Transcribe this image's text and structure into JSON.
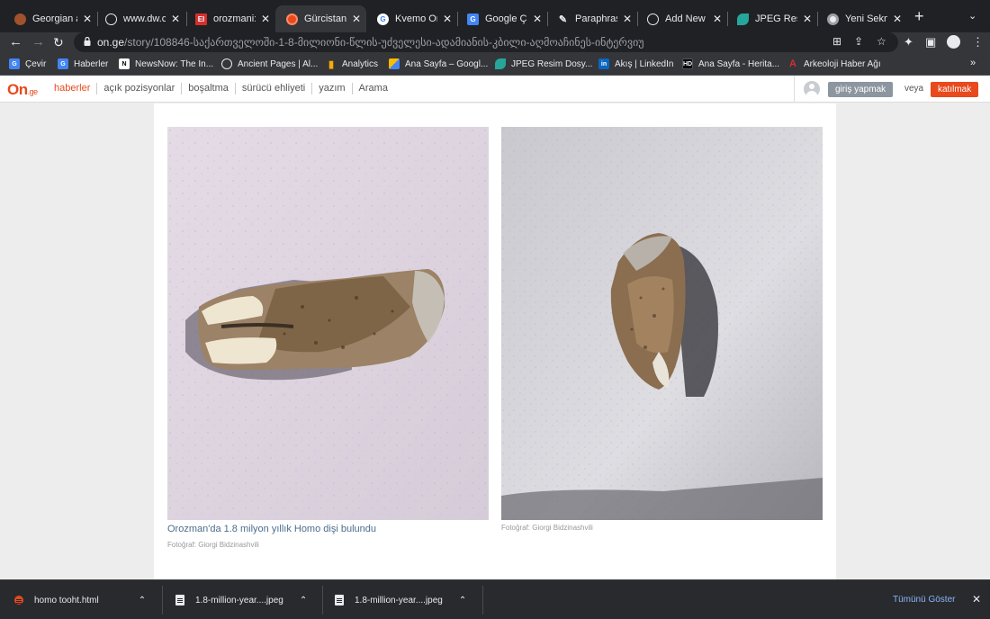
{
  "tabs": [
    {
      "title": "Georgian ar",
      "icon": "brown-circle-icon",
      "color": "#a0522d",
      "active": false
    },
    {
      "title": "www.dw.co",
      "icon": "globe-icon",
      "color": "#9aa0a6",
      "active": false
    },
    {
      "title": "orozmani: A",
      "icon": "ei-icon",
      "color": "#d32f2f",
      "active": false
    },
    {
      "title": "Gürcistan'd",
      "icon": "orange-circle-icon",
      "color": "#e8491d",
      "active": true
    },
    {
      "title": "Kvemo Oroz",
      "icon": "google-icon",
      "color": "#4285f4",
      "active": false
    },
    {
      "title": "Google Çev",
      "icon": "translate-icon",
      "color": "#4285f4",
      "active": false
    },
    {
      "title": "Paraphrasin",
      "icon": "feather-icon",
      "color": "#9aa0a6",
      "active": false
    },
    {
      "title": "Add New Po",
      "icon": "wordpress-icon",
      "color": "#3c3c3c",
      "active": false
    },
    {
      "title": "JPEG Resim",
      "icon": "leaf-icon",
      "color": "#26a69a",
      "active": false
    },
    {
      "title": "Yeni Sekme",
      "icon": "chrome-icon",
      "color": "#9aa0a6",
      "active": false
    }
  ],
  "toolbar": {
    "url_host": "on.ge",
    "url_path": "/story/108846-საქართველოში-1-8-მილიონი-წლის-უძველესი-ადამიანის-კბილი-აღმოაჩინეს-ინტერვიუ"
  },
  "bookmarks": [
    {
      "label": "Çevir",
      "icon": "translate-icon",
      "color": "#4285f4"
    },
    {
      "label": "Haberler",
      "icon": "gnews-icon",
      "color": "#4285f4"
    },
    {
      "label": "NewsNow: The In...",
      "icon": "newsnow-icon",
      "color": "#ffffff"
    },
    {
      "label": "Ancient Pages | Al...",
      "icon": "globe-icon",
      "color": "#9aa0a6"
    },
    {
      "label": "Analytics",
      "icon": "analytics-icon",
      "color": "#f9ab00"
    },
    {
      "label": "Ana Sayfa – Googl...",
      "icon": "adsense-icon",
      "color": "#fbbc04"
    },
    {
      "label": "JPEG Resim Dosy...",
      "icon": "leaf-icon",
      "color": "#26a69a"
    },
    {
      "label": "Akış | LinkedIn",
      "icon": "linkedin-icon",
      "color": "#0a66c2"
    },
    {
      "label": "Ana Sayfa - Herita...",
      "icon": "hd-icon",
      "color": "#000000"
    },
    {
      "label": "Arkeoloji Haber Ağı",
      "icon": "arkeoloji-icon",
      "color": "#d32f2f"
    }
  ],
  "site": {
    "logo_main": "On",
    "logo_suffix": ".ge",
    "nav": [
      "haberler",
      "açık pozisyonlar",
      "boşaltma",
      "sürücü ehliyeti",
      "yazım",
      "Arama"
    ],
    "login_label": "giriş yapmak",
    "or_label": "veya",
    "join_label": "katılmak",
    "accent": "#e8491d"
  },
  "article": {
    "caption": "Orozman'da 1.8 milyon yıllık Homo dişi bulundu",
    "credit_left": "Fotoğraf: Giorgi Bidzinashvili",
    "credit_right": "Fotoğraf: Giorgi Bidzinashvili"
  },
  "downloads": {
    "items": [
      {
        "name": "homo tooht.html",
        "icon": "html-file-icon"
      },
      {
        "name": "1.8-million-year....jpeg",
        "icon": "file-icon"
      },
      {
        "name": "1.8-million-year....jpeg",
        "icon": "file-icon"
      }
    ],
    "show_all": "Tümünü Göster"
  }
}
